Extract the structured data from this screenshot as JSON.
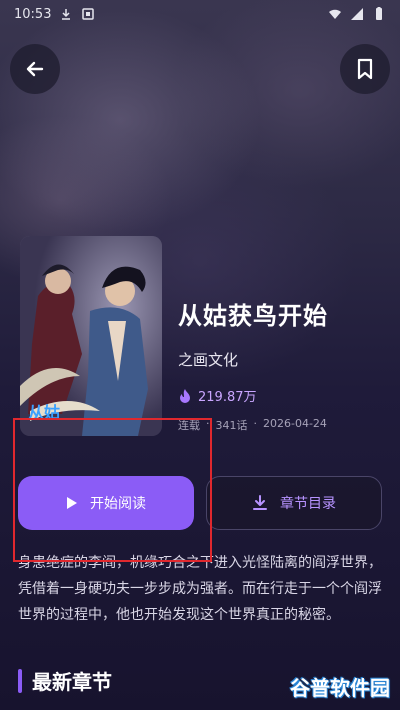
{
  "status_bar": {
    "time": "10:53"
  },
  "book": {
    "title": "从姑获鸟开始",
    "publisher": "之画文化",
    "hot_count": "219.87万",
    "status": "连载",
    "chapters": "341话",
    "date": "2026-04-24",
    "description": "身患绝症的李阎，机缘巧合之下进入光怪陆离的阎浮世界，凭借着一身硬功夫一步步成为强者。而在行走于一个个阎浮世界的过程中，他也开始发现这个世界真正的秘密。"
  },
  "buttons": {
    "read": "开始阅读",
    "chapters": "章节目录"
  },
  "section": {
    "latest_chapters": "最新章节"
  },
  "watermark": "谷普软件园",
  "colors": {
    "accent": "#8b5cf6",
    "accent_text": "#b793ff",
    "highlight": "#e0282e"
  },
  "icons": [
    "back-arrow-icon",
    "bookmark-icon",
    "flame-icon",
    "play-icon",
    "download-icon"
  ]
}
